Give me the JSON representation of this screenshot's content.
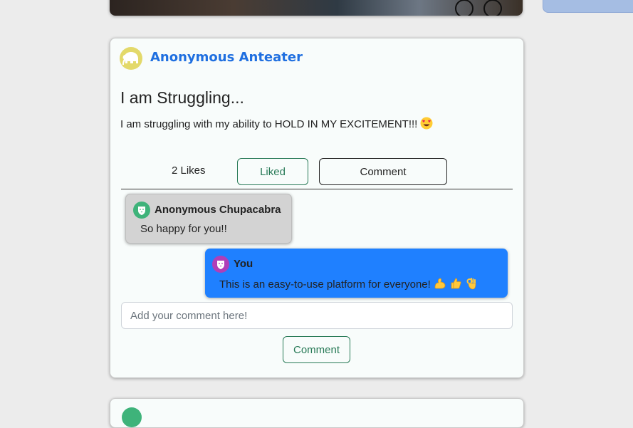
{
  "post": {
    "author": "Anonymous Anteater",
    "author_avatar_icon": "elephant-icon",
    "title": "I am Struggling...",
    "body": "I am struggling with my ability to HOLD IN MY EXCITEMENT!!!",
    "body_emoji": "heart-eyes-emoji",
    "likes_text": "2 Likes",
    "liked_label": "Liked",
    "comment_toggle_label": "Comment"
  },
  "comments": [
    {
      "author": "Anonymous Chupacabra",
      "text": "So happy for you!!",
      "avatar_icon": "lion-icon",
      "avatar_color": "#3eb37a",
      "bubble_color": "#d3d3d3"
    },
    {
      "author": "You",
      "text": "This is an easy-to-use platform for everyone!",
      "emojis": [
        "flexed-biceps-emoji",
        "thumbs-up-emoji",
        "ok-hand-emoji"
      ],
      "avatar_icon": "lion-icon",
      "avatar_color": "#b03fb8",
      "bubble_color": "#1f80ff"
    }
  ],
  "comment_form": {
    "placeholder": "Add your comment here!",
    "value": "",
    "submit_label": "Comment"
  },
  "colors": {
    "accent_blue": "#1f6fe0",
    "success_green": "#287a57",
    "page_bg": "#ececec",
    "card_bg": "#f8fcfb"
  }
}
